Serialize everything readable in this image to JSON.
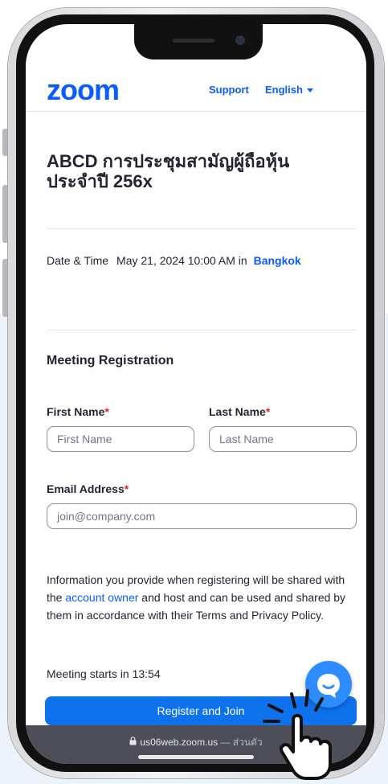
{
  "header": {
    "logo": "zoom",
    "support_label": "Support",
    "language_label": "English"
  },
  "meeting": {
    "title": "ABCD การประชุมสามัญผู้ถือหุ้น ประจำปี 256x",
    "datetime_label": "Date & Time",
    "datetime_value": "May 21, 2024 10:00 AM",
    "datetime_in": "in",
    "timezone": "Bangkok"
  },
  "registration": {
    "section_title": "Meeting Registration",
    "first_name_label": "First Name",
    "first_name_placeholder": "First Name",
    "last_name_label": "Last Name",
    "last_name_placeholder": "Last Name",
    "email_label": "Email Address",
    "email_placeholder": "join@company.com",
    "required_mark": "*",
    "info_part1": "Information you provide when registering will be shared with the ",
    "info_link": "account owner",
    "info_part2": " and host and can be used and shared by them in accordance with their Terms and Privacy Policy.",
    "starts_text": "Meeting starts in 13:54",
    "register_button": "Register and Join"
  },
  "browser": {
    "url": "us06web.zoom.us",
    "separator": " — ",
    "mode": "ส่วนตัว"
  },
  "colors": {
    "brand": "#0b5cff",
    "button": "#0e72ed",
    "required": "#e02828"
  }
}
